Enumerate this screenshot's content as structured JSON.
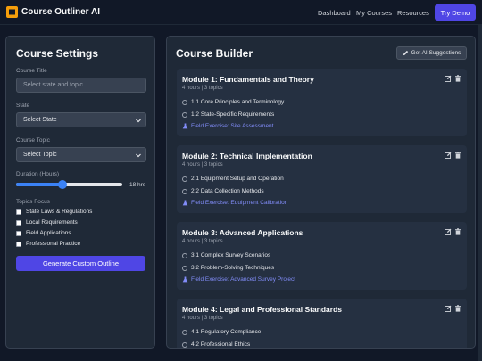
{
  "nav": {
    "brand": "Course Outliner AI",
    "links": [
      "Dashboard",
      "My Courses",
      "Resources"
    ],
    "cta": "Try Demo"
  },
  "settings": {
    "title": "Course Settings",
    "course_title_label": "Course Title",
    "course_title_placeholder": "Select state and topic",
    "state_label": "State",
    "state_value": "Select State",
    "topic_label": "Course Topic",
    "topic_value": "Select Topic",
    "duration_label": "Duration (Hours)",
    "duration_value": 18,
    "duration_min": 1,
    "duration_max": 40,
    "duration_text": "18 hrs",
    "topics_focus_label": "Topics Focus",
    "topics_focus": [
      "State Laws & Regulations",
      "Local Requirements",
      "Field Applications",
      "Professional Practice"
    ],
    "generate_label": "Generate Custom Outline"
  },
  "builder": {
    "title": "Course Builder",
    "ai_button": "Get AI Suggestions",
    "modules": [
      {
        "title": "Module 1: Fundamentals and Theory",
        "meta": "4 hours | 3 topics",
        "topics": [
          "1.1 Core Principles and Terminology",
          "1.2 State-Specific Requirements"
        ],
        "exercise": "Field Exercise: Site Assessment"
      },
      {
        "title": "Module 2: Technical Implementation",
        "meta": "4 hours | 3 topics",
        "topics": [
          "2.1 Equipment Setup and Operation",
          "2.2 Data Collection Methods"
        ],
        "exercise": "Field Exercise: Equipment Calibration"
      },
      {
        "title": "Module 3: Advanced Applications",
        "meta": "4 hours | 3 topics",
        "topics": [
          "3.1 Complex Survey Scenarios",
          "3.2 Problem-Solving Techniques"
        ],
        "exercise": "Field Exercise: Advanced Survey Project"
      },
      {
        "title": "Module 4: Legal and Professional Standards",
        "meta": "4 hours | 3 topics",
        "topics": [
          "4.1 Regulatory Compliance",
          "4.2 Professional Ethics"
        ],
        "exercise": ""
      }
    ]
  },
  "colors": {
    "accent": "#4f46e5",
    "slider": "#3b82f6",
    "logo": "#f59e0b",
    "exercise_link": "#818cf8"
  },
  "icons": {
    "logo": "book-icon",
    "ai": "pencil-icon",
    "edit": "edit-icon",
    "delete": "trash-icon",
    "topic": "circle-icon",
    "exercise": "flask-icon",
    "select": "chevron-down-icon"
  }
}
